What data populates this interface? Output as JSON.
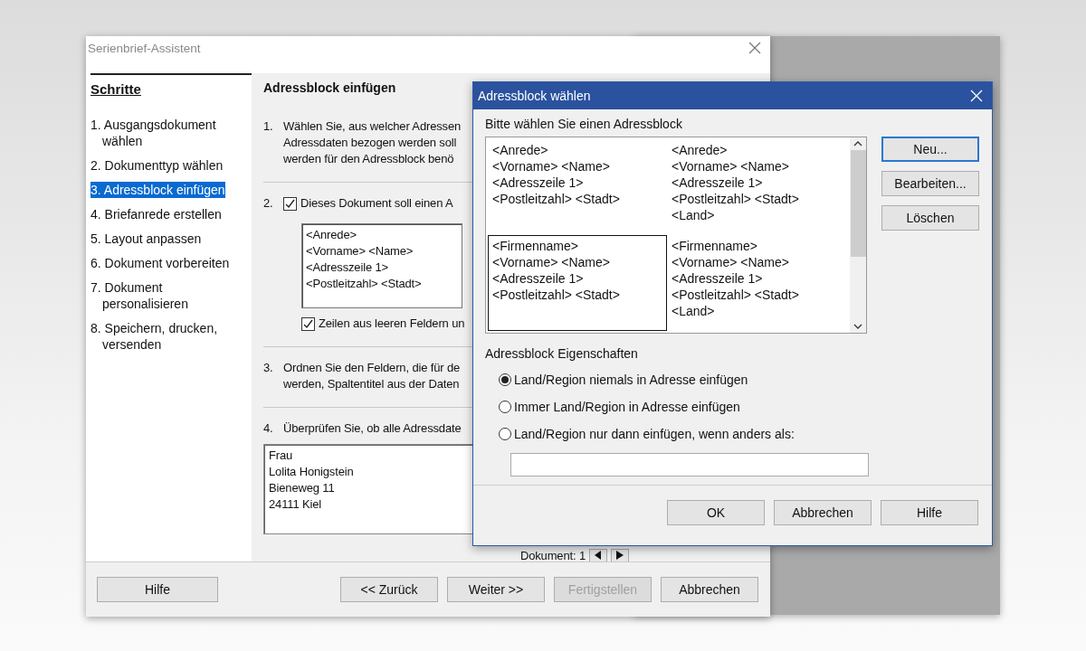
{
  "wizard": {
    "title": "Serienbrief-Assistent",
    "steps_heading": "Schritte",
    "steps": [
      {
        "label": "1. Ausgangsdokument wählen",
        "selected": false
      },
      {
        "label": "2. Dokumenttyp wählen",
        "selected": false
      },
      {
        "label": "3. Adressblock einfügen",
        "selected": true
      },
      {
        "label": "4. Briefanrede erstellen",
        "selected": false
      },
      {
        "label": "5. Layout anpassen",
        "selected": false
      },
      {
        "label": "6. Dokument vorbereiten",
        "selected": false
      },
      {
        "label": "7. Dokument personalisieren",
        "selected": false
      },
      {
        "label": "8. Speichern, drucken, versenden",
        "selected": false
      }
    ],
    "page_title": "Adressblock einfügen",
    "sections": [
      {
        "kind": "text",
        "number": "1.",
        "lines": [
          "Wählen Sie, aus welcher Adressen",
          "Adressdaten bezogen werden soll",
          "werden für den Adressblock benö"
        ]
      },
      {
        "kind": "address",
        "number": "2.",
        "checkbox": {
          "label": "Dieses Dokument soll einen A",
          "checked": true
        },
        "preview_lines": [
          "<Anrede>",
          "<Vorname> <Name>",
          "<Adresszeile 1>",
          "<Postleitzahl> <Stadt>"
        ],
        "checkbox2": {
          "label": "Zeilen aus leeren Feldern un",
          "checked": true
        }
      },
      {
        "kind": "text",
        "number": "3.",
        "lines": [
          "Ordnen Sie den Feldern, die für de",
          "werden, Spaltentitel aus der Daten"
        ]
      },
      {
        "kind": "preview",
        "number": "4.",
        "lines": [
          "Überprüfen Sie, ob alle Adressdate"
        ],
        "preview_lines": [
          "Frau",
          "Lolita Honigstein",
          "Bieneweg 11",
          "24111 Kiel"
        ],
        "document_label": "Dokument: 1"
      }
    ],
    "help_button": "Hilfe",
    "buttons": [
      {
        "label": "<< Zurück",
        "disabled": false
      },
      {
        "label": "Weiter >>",
        "disabled": false
      },
      {
        "label": "Fertigstellen",
        "disabled": true
      },
      {
        "label": "Abbrechen",
        "disabled": false
      }
    ]
  },
  "dialog": {
    "title": "Adressblock wählen",
    "prompt": "Bitte wählen Sie einen Adressblock",
    "blocks": [
      {
        "lines": [
          "<Anrede>",
          "<Vorname> <Name>",
          "<Adresszeile 1>",
          "<Postleitzahl> <Stadt>"
        ],
        "selected": false
      },
      {
        "lines": [
          "<Anrede>",
          "<Vorname> <Name>",
          "<Adresszeile 1>",
          "<Postleitzahl> <Stadt>",
          "<Land>"
        ],
        "selected": false
      },
      {
        "lines": [
          "<Firmenname>",
          "<Vorname> <Name>",
          "<Adresszeile 1>",
          "<Postleitzahl> <Stadt>"
        ],
        "selected": true
      },
      {
        "lines": [
          "<Firmenname>",
          "<Vorname> <Name>",
          "<Adresszeile 1>",
          "<Postleitzahl> <Stadt>",
          "<Land>"
        ],
        "selected": false
      }
    ],
    "side_buttons": [
      {
        "label": "Neu...",
        "focused": true
      },
      {
        "label": "Bearbeiten...",
        "focused": false
      },
      {
        "label": "Löschen",
        "focused": false
      }
    ],
    "properties_label": "Adressblock Eigenschaften",
    "options": [
      {
        "label": "Land/Region niemals in Adresse einfügen",
        "selected": true
      },
      {
        "label": "Immer Land/Region in Adresse einfügen",
        "selected": false
      },
      {
        "label": "Land/Region nur dann einfügen, wenn anders als:",
        "selected": false
      }
    ],
    "buttons": [
      "OK",
      "Abbrechen",
      "Hilfe"
    ]
  }
}
